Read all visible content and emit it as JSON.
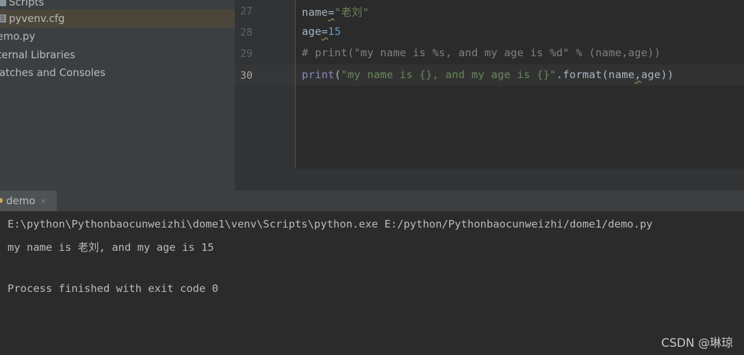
{
  "project_tree": {
    "items": [
      {
        "label": "Scripts",
        "icon": "folder-icon"
      },
      {
        "label": "pyvenv.cfg",
        "icon": "file-icon",
        "selected": true
      },
      {
        "label": "demo.py"
      },
      {
        "label": "External Libraries"
      },
      {
        "label": "Scratches and Consoles"
      }
    ]
  },
  "editor": {
    "line_numbers": [
      "27",
      "28",
      "29",
      "30"
    ],
    "current_line": "30",
    "lines": [
      [
        [
          "ident",
          "name"
        ],
        [
          "ident",
          "="
        ],
        [
          "str",
          "\"老刘\""
        ]
      ],
      [
        [
          "ident",
          "age"
        ],
        [
          "ident",
          "="
        ],
        [
          "num",
          "15"
        ]
      ],
      [
        [
          "comment",
          "# print(\"my name is %s, and my age is %d\" % (name,age))"
        ]
      ],
      [
        [
          "builtin",
          "print"
        ],
        [
          "ident",
          "("
        ],
        [
          "str",
          "\"my name is {}, and my age is {}\""
        ],
        [
          "ident",
          ".format(name"
        ],
        [
          "ident",
          ","
        ],
        [
          "ident",
          "age))"
        ]
      ]
    ]
  },
  "run": {
    "tab_label": "demo",
    "tab_close": "×",
    "console": [
      "E:\\python\\Pythonbaocunweizhi\\dome1\\venv\\Scripts\\python.exe E:/python/Pythonbaocunweizhi/dome1/demo.py",
      "my name is 老刘, and my age is 15",
      "",
      "Process finished with exit code 0"
    ]
  },
  "watermark": "CSDN @琳琼",
  "colors": {
    "string": "#6a8759",
    "number": "#6897bb",
    "comment": "#808080",
    "builtin": "#8888c6",
    "identifier": "#a9b7c6"
  }
}
